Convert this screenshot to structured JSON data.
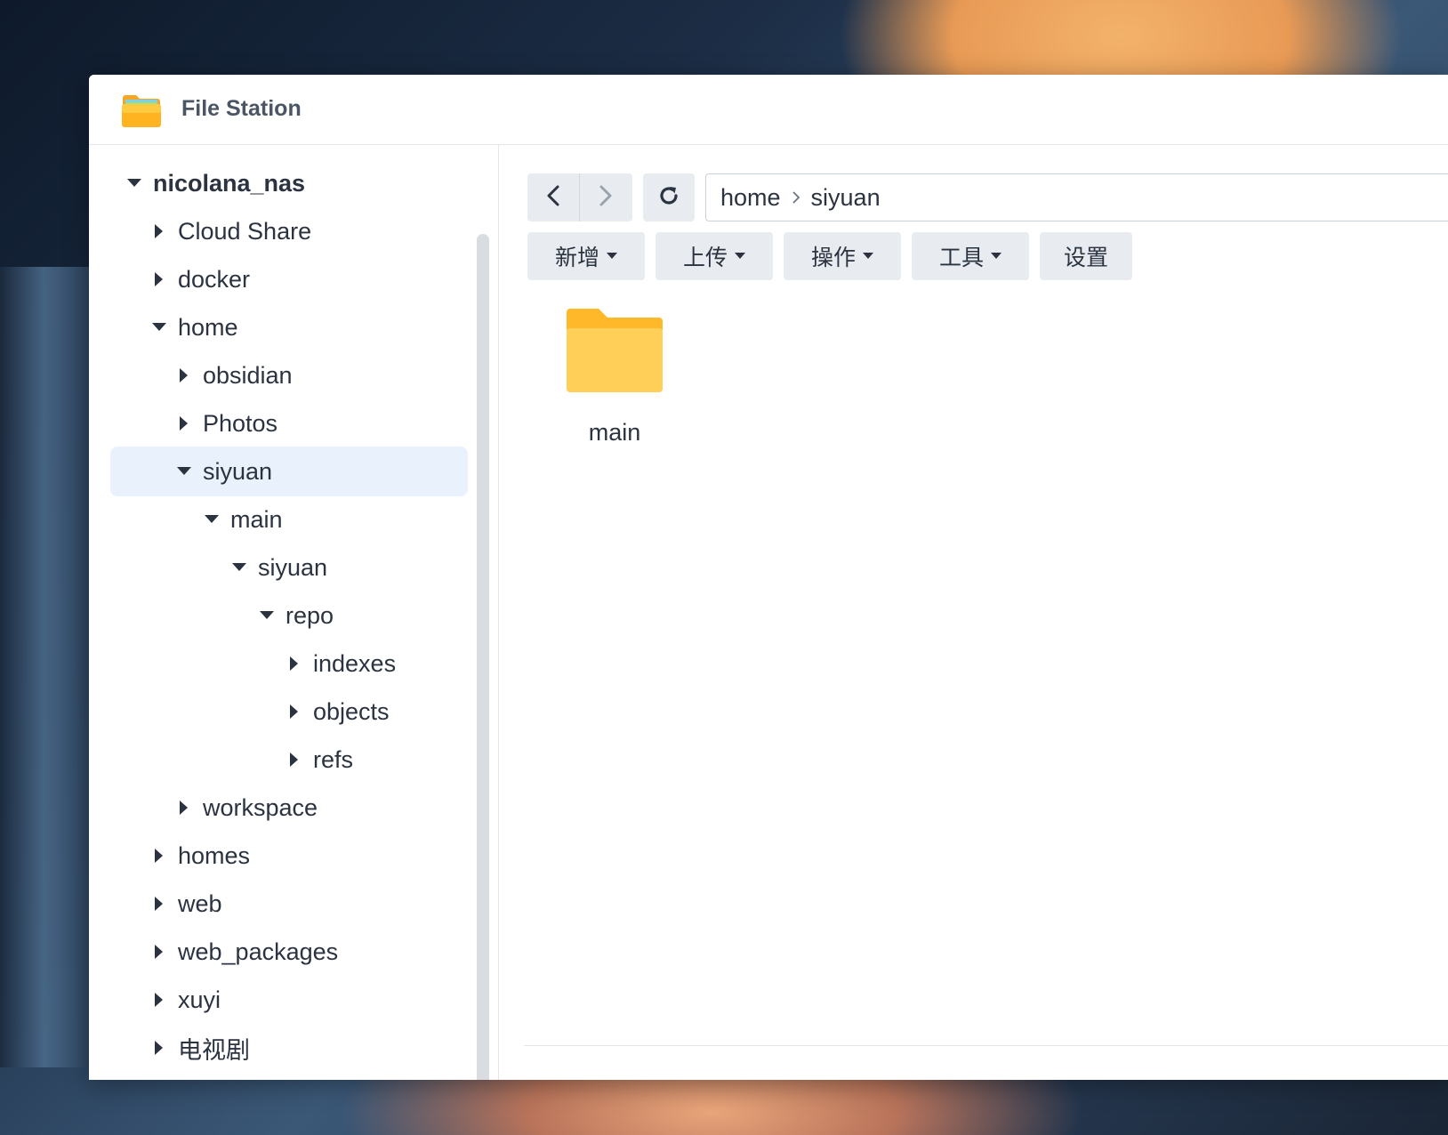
{
  "window": {
    "title": "File Station"
  },
  "sidebar": {
    "items": [
      {
        "label": "nicolana_nas",
        "expanded": true
      },
      {
        "label": "Cloud Share",
        "expanded": false
      },
      {
        "label": "docker",
        "expanded": false
      },
      {
        "label": "home",
        "expanded": true
      },
      {
        "label": "obsidian",
        "expanded": false
      },
      {
        "label": "Photos",
        "expanded": false
      },
      {
        "label": "siyuan",
        "expanded": true,
        "selected": true
      },
      {
        "label": "main",
        "expanded": true
      },
      {
        "label": "siyuan",
        "expanded": true
      },
      {
        "label": "repo",
        "expanded": true
      },
      {
        "label": "indexes",
        "expanded": false
      },
      {
        "label": "objects",
        "expanded": false
      },
      {
        "label": "refs",
        "expanded": false
      },
      {
        "label": "workspace",
        "expanded": false
      },
      {
        "label": "homes",
        "expanded": false
      },
      {
        "label": "web",
        "expanded": false
      },
      {
        "label": "web_packages",
        "expanded": false
      },
      {
        "label": "xuyi",
        "expanded": false
      },
      {
        "label": "电视剧",
        "expanded": false
      }
    ]
  },
  "path": {
    "segments": [
      "home",
      "siyuan"
    ]
  },
  "toolbar": {
    "new_label": "新增",
    "upload_label": "上传",
    "action_label": "操作",
    "tools_label": "工具",
    "settings_label": "设置"
  },
  "files": [
    {
      "name": "main",
      "type": "folder"
    }
  ],
  "colors": {
    "selection": "#e8f1fc",
    "button_bg": "#e8ecf0",
    "folder": "#ffcf57"
  }
}
